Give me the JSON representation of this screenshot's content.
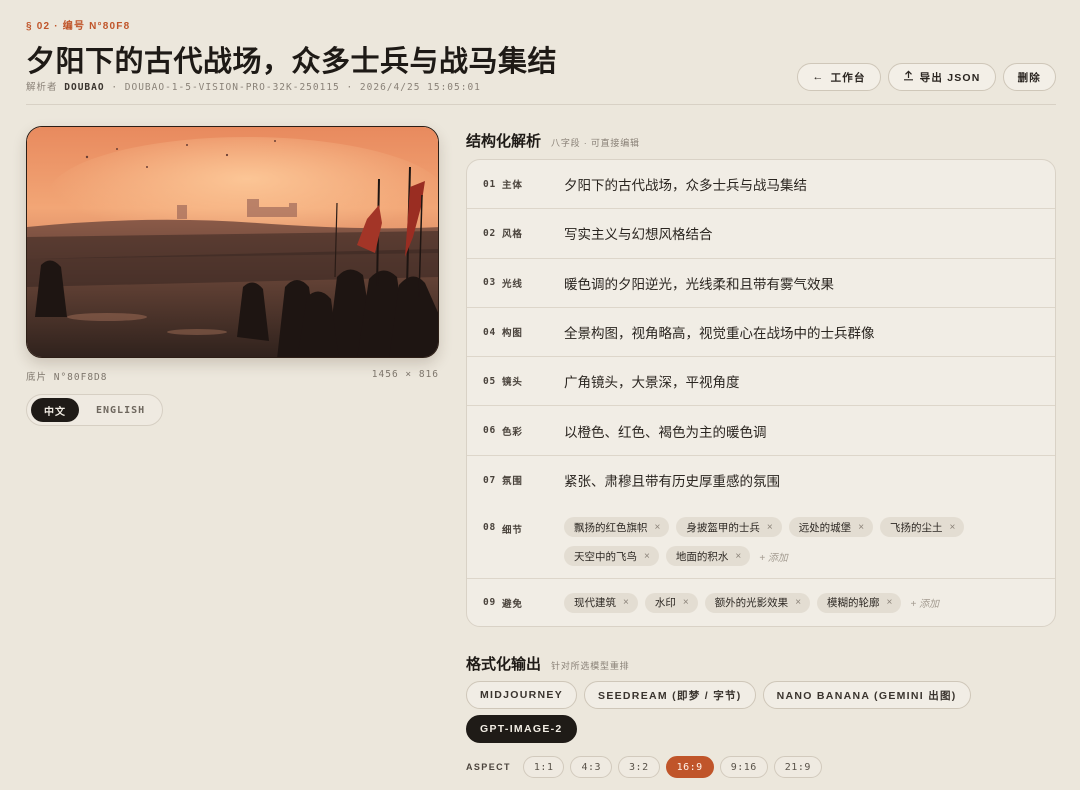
{
  "header": {
    "eyebrow": "§ 02 · 编号 N°80F8",
    "title": "夕阳下的古代战场，众多士兵与战马集结",
    "meta_prefix": "解析者",
    "meta_who": "DOUBAO",
    "meta_rest": "· DOUBAO-1-5-VISION-PRO-32K-250115 · 2026/4/25 15:05:01"
  },
  "actions": {
    "workbench": "工作台",
    "export": "导出 JSON",
    "delete": "删除"
  },
  "photo": {
    "caption_left": "底片 N°80F8D8",
    "caption_right": "1456 × 816"
  },
  "lang": {
    "zh": "中文",
    "en": "ENGLISH"
  },
  "structured": {
    "title": "结构化解析",
    "subtitle": "八字段 · 可直接编辑",
    "rows": [
      {
        "num": "01",
        "label": "主体",
        "value": "夕阳下的古代战场，众多士兵与战马集结"
      },
      {
        "num": "02",
        "label": "风格",
        "value": "写实主义与幻想风格结合"
      },
      {
        "num": "03",
        "label": "光线",
        "value": "暖色调的夕阳逆光，光线柔和且带有雾气效果"
      },
      {
        "num": "04",
        "label": "构图",
        "value": "全景构图，视角略高，视觉重心在战场中的士兵群像"
      },
      {
        "num": "05",
        "label": "镜头",
        "value": "广角镜头，大景深，平视角度"
      },
      {
        "num": "06",
        "label": "色彩",
        "value": "以橙色、红色、褐色为主的暖色调"
      },
      {
        "num": "07",
        "label": "氛围",
        "value": "紧张、肃穆且带有历史厚重感的氛围"
      }
    ],
    "details": {
      "num": "08",
      "label": "细节",
      "chips": [
        "飘扬的红色旗帜",
        "身披盔甲的士兵",
        "远处的城堡",
        "飞扬的尘土",
        "天空中的飞鸟",
        "地面的积水"
      ],
      "add": "+ 添加"
    },
    "avoid": {
      "num": "09",
      "label": "避免",
      "chips": [
        "现代建筑",
        "水印",
        "额外的光影效果",
        "模糊的轮廓"
      ],
      "add": "+ 添加"
    },
    "chip_close": "×"
  },
  "format": {
    "title": "格式化输出",
    "subtitle": "针对所选模型重排",
    "models": [
      "MIDJOURNEY",
      "SEEDREAM (即梦 / 字节)",
      "NANO BANANA (GEMINI 出图)",
      "GPT-IMAGE-2"
    ],
    "active_model": "GPT-IMAGE-2",
    "aspect_label": "ASPECT",
    "aspects": [
      "1:1",
      "4:3",
      "3:2",
      "16:9",
      "9:16",
      "21:9"
    ],
    "active_aspect": "16:9"
  },
  "colors": {
    "accent": "#c0552a",
    "background": "#ece7dc",
    "dark": "#1f1b17"
  }
}
